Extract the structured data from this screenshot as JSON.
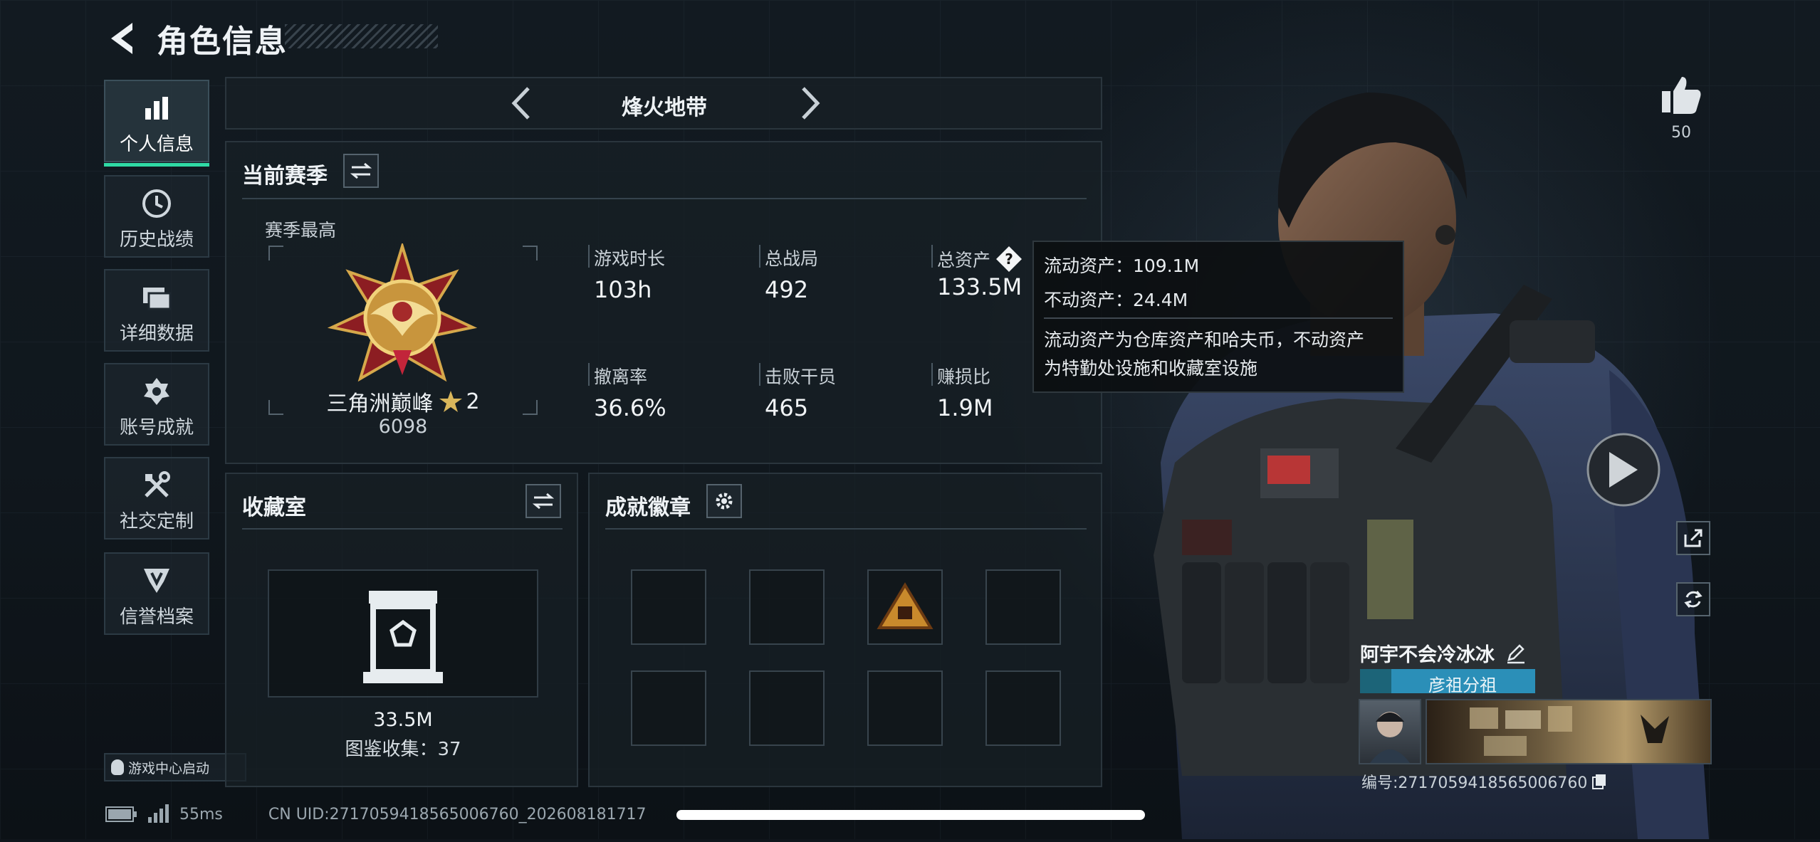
{
  "header": {
    "title": "角色信息"
  },
  "nav": {
    "items": [
      {
        "label": "个人信息",
        "icon": "bar-chart-icon",
        "active": true
      },
      {
        "label": "历史战绩",
        "icon": "clock-icon",
        "active": false
      },
      {
        "label": "详细数据",
        "icon": "folder-icon",
        "active": false
      },
      {
        "label": "账号成就",
        "icon": "medal-icon",
        "active": false
      },
      {
        "label": "社交定制",
        "icon": "tools-icon",
        "active": false
      },
      {
        "label": "信誉档案",
        "icon": "shield-icon",
        "active": false
      }
    ],
    "game_center": "游戏中心启动"
  },
  "mode_switcher": {
    "label": "烽火地带"
  },
  "season": {
    "title": "当前赛季",
    "highest_label": "赛季最高",
    "rank_name": "三角洲巅峰",
    "rank_stars": "2",
    "rank_score": "6098",
    "stats": [
      {
        "label": "游戏时长",
        "value": "103h"
      },
      {
        "label": "总战局",
        "value": "492"
      },
      {
        "label": "总资产",
        "value": "133.5M"
      },
      {
        "label": "撤离率",
        "value": "36.6%"
      },
      {
        "label": "击败干员",
        "value": "465"
      },
      {
        "label": "赚损比",
        "value": "1.9M"
      }
    ]
  },
  "tooltip": {
    "liquid": "流动资产：109.1M",
    "fixed": "不动资产：24.4M",
    "desc_line1": "流动资产为仓库资产和哈夫币，不动资产",
    "desc_line2": "为特勤处设施和收藏室设施"
  },
  "collection": {
    "title": "收藏室",
    "value": "33.5M",
    "catalog": "图鉴收集：37"
  },
  "achievements": {
    "title": "成就徽章"
  },
  "profile": {
    "likes": "50",
    "name": "阿宇不会冷冰冰",
    "group": "彦祖分祖",
    "id_text": "编号:2717059418565006760"
  },
  "status_bar": {
    "ping": "55ms",
    "uid": "CN UID:2717059418565006760_202608181717"
  },
  "colors": {
    "accent": "#2fd9a4",
    "panel_border": "#2a353d",
    "group_tag": "#2b8fb8"
  }
}
